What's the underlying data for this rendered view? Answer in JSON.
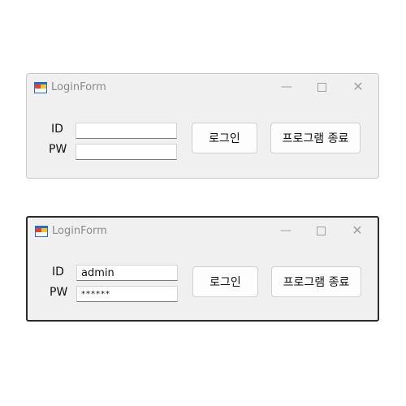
{
  "windows": [
    {
      "title": "LoginForm",
      "id_label": "ID",
      "pw_label": "PW",
      "id_value": "",
      "pw_value": "",
      "login_button": "로그인",
      "exit_button": "프로그램 종료",
      "controls": {
        "minimize": "—",
        "close": "✕"
      }
    },
    {
      "title": "LoginForm",
      "id_label": "ID",
      "pw_label": "PW",
      "id_value": "admin",
      "pw_value": "******",
      "login_button": "로그인",
      "exit_button": "프로그램 종료",
      "controls": {
        "minimize": "—",
        "close": "✕"
      }
    }
  ],
  "colors": {
    "window_bg": "#f0f0f0",
    "title_text": "#8a8a8a",
    "button_bg": "#fdfdfd",
    "dark_border": "#2b2b2b"
  },
  "icons": [
    "app-form-icon",
    "minimize-icon",
    "maximize-icon",
    "close-icon"
  ]
}
